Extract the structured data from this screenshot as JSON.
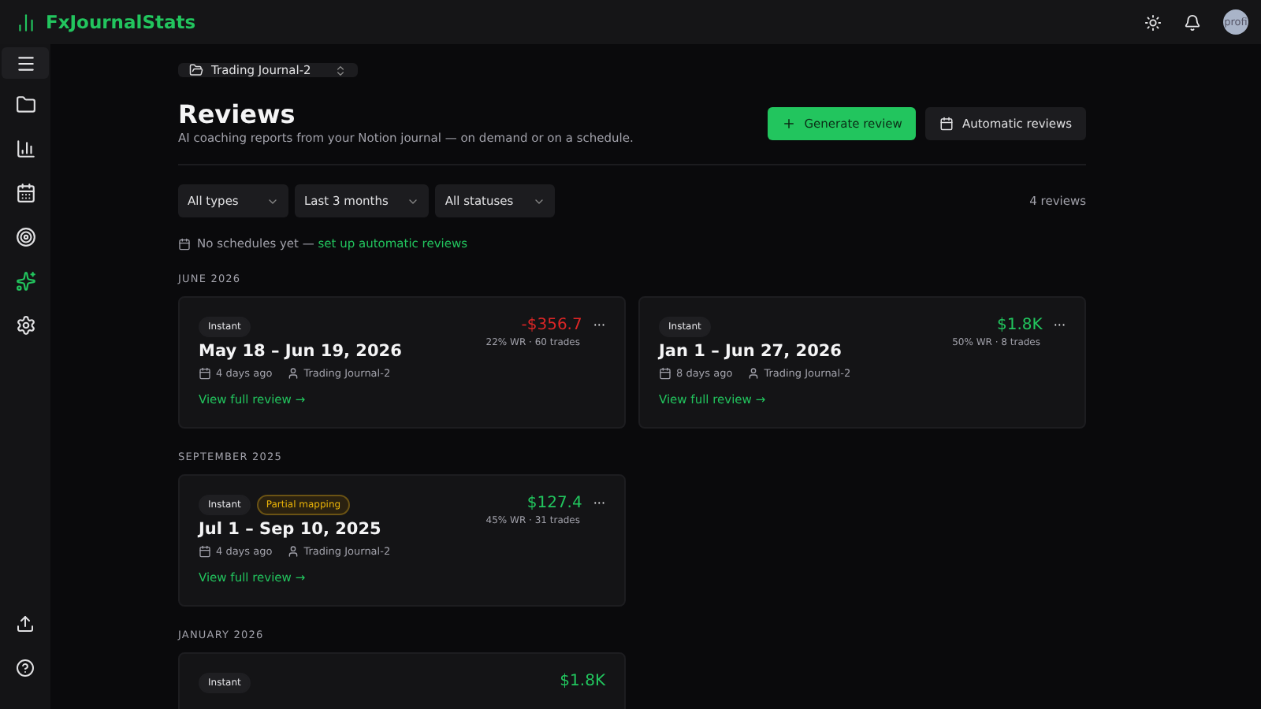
{
  "app": {
    "name": "FxJournalStats",
    "avatar": "profi"
  },
  "sidebar": {
    "items": [
      {
        "kind": "folder",
        "selected": false
      },
      {
        "kind": "chart",
        "selected": false
      },
      {
        "kind": "calendar",
        "selected": false
      },
      {
        "kind": "target",
        "selected": false
      },
      {
        "kind": "sparkle",
        "selected": true
      },
      {
        "kind": "settings",
        "selected": false
      }
    ],
    "bottom": [
      {
        "kind": "upload"
      },
      {
        "kind": "help"
      }
    ]
  },
  "journal_selector": {
    "value": "Trading Journal-2"
  },
  "header": {
    "title": "Reviews",
    "subtitle": "AI coaching reports from your Notion journal — on demand or on a schedule.",
    "primary_button": "Generate review",
    "secondary_button": "Automatic reviews"
  },
  "filters": [
    {
      "value": "All types"
    },
    {
      "value": "Last 3 months"
    },
    {
      "value": "All statuses"
    }
  ],
  "count": "4 reviews",
  "schedule_note": {
    "text": "No schedules yet — ",
    "link": "set up automatic reviews"
  },
  "sections": [
    {
      "label": "JUNE 2026",
      "reviews": [
        {
          "badges": [
            {
              "label": "Instant",
              "kind": "neutral"
            }
          ],
          "title": "May 18 – Jun 19, 2026",
          "amount": "-$356.7",
          "color": "#dc2626",
          "more": "···",
          "stats": "22% WR · 60 trades",
          "age": "4 days ago",
          "journal": "Trading Journal-2",
          "link": "View full review →"
        },
        {
          "badges": [
            {
              "label": "Instant",
              "kind": "neutral"
            }
          ],
          "title": "Jan 1 – Jun 27, 2026",
          "amount": "$1.8K",
          "color": "#22c55e",
          "more": "···",
          "stats": "50% WR · 8 trades",
          "age": "8 days ago",
          "journal": "Trading Journal-2",
          "link": "View full review →"
        }
      ]
    },
    {
      "label": "SEPTEMBER 2025",
      "reviews": [
        {
          "badges": [
            {
              "label": "Instant",
              "kind": "neutral"
            },
            {
              "label": "Partial mapping",
              "kind": "warning"
            }
          ],
          "title": "Jul 1 – Sep 10, 2025",
          "amount": "$127.4",
          "color": "#22c55e",
          "more": "···",
          "stats": "45% WR · 31 trades",
          "age": "4 days ago",
          "journal": "Trading Journal-2",
          "link": "View full review →"
        }
      ]
    },
    {
      "label": "JANUARY 2026",
      "reviews": [
        {
          "badges": [
            {
              "label": "Instant",
              "kind": "neutral"
            }
          ],
          "amount": "$1.8K",
          "color": "#22c55e"
        }
      ]
    }
  ]
}
